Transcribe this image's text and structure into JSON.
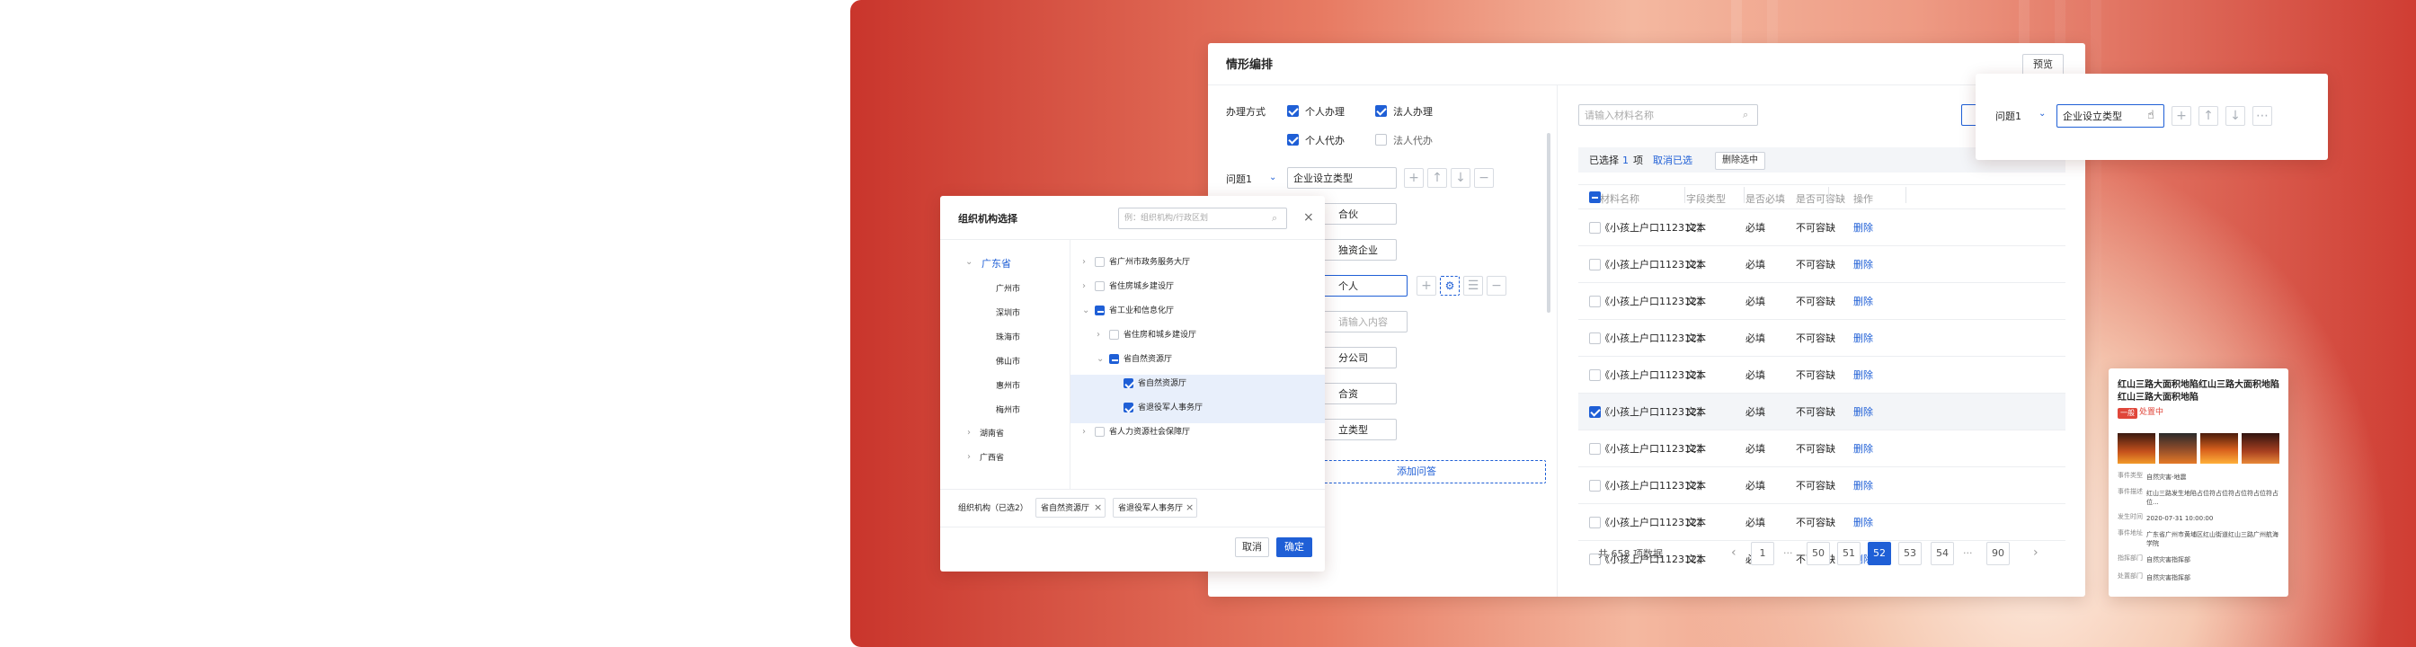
{
  "main": {
    "title": "情形编排",
    "preview_label": "预览",
    "handling_label": "办理方式",
    "handling_options": [
      {
        "label": "个人办理",
        "checked": true
      },
      {
        "label": "法人办理",
        "checked": true
      },
      {
        "label": "个人代办",
        "checked": true
      },
      {
        "label": "法人代办",
        "checked": false
      }
    ],
    "question_label": "问题1",
    "question_value": "企业设立类型",
    "answers": [
      "合伙",
      "独资企业",
      "个人",
      "请输入内容",
      "分公司",
      "合资",
      "立类型"
    ],
    "add_question_label": "添加问答",
    "material_search_placeholder": "请输入材料名称",
    "selected_prefix": "已选择",
    "selected_count": "1",
    "selected_suffix": "项",
    "cancel_selection": "取消已选",
    "delete_selected": "删除选中",
    "table": {
      "headers": [
        "材料名称",
        "字段类型",
        "是否必填",
        "是否可容缺",
        "操作"
      ],
      "rows": [
        {
          "name": "《小孩上户口112312》",
          "type": "文本",
          "required": "必填",
          "missing": "不可容缺",
          "action": "删除",
          "checked": false
        },
        {
          "name": "《小孩上户口112312》",
          "type": "文本",
          "required": "必填",
          "missing": "不可容缺",
          "action": "删除",
          "checked": false
        },
        {
          "name": "《小孩上户口112312》",
          "type": "文本",
          "required": "必填",
          "missing": "不可容缺",
          "action": "删除",
          "checked": false
        },
        {
          "name": "《小孩上户口112312》",
          "type": "文本",
          "required": "必填",
          "missing": "不可容缺",
          "action": "删除",
          "checked": false
        },
        {
          "name": "《小孩上户口112312》",
          "type": "文本",
          "required": "必填",
          "missing": "不可容缺",
          "action": "删除",
          "checked": false
        },
        {
          "name": "《小孩上户口112312》",
          "type": "文本",
          "required": "必填",
          "missing": "不可容缺",
          "action": "删除",
          "checked": true
        },
        {
          "name": "《小孩上户口112312》",
          "type": "文本",
          "required": "必填",
          "missing": "不可容缺",
          "action": "删除",
          "checked": false
        },
        {
          "name": "《小孩上户口112312》",
          "type": "文本",
          "required": "必填",
          "missing": "不可容缺",
          "action": "删除",
          "checked": false
        },
        {
          "name": "《小孩上户口112312》",
          "type": "文本",
          "required": "必填",
          "missing": "不可容缺",
          "action": "删除",
          "checked": false
        },
        {
          "name": "《小孩上户口112312》",
          "type": "文本",
          "required": "必填",
          "missing": "不可容缺",
          "action": "删除",
          "checked": false
        }
      ]
    },
    "total_text": "共 658 项数据",
    "pages": [
      "1",
      "···",
      "50",
      "51",
      "52",
      "53",
      "54",
      "···",
      "90"
    ],
    "current_page": "52"
  },
  "popover": {
    "question_label": "问题1",
    "question_value": "企业设立类型"
  },
  "org_dialog": {
    "title": "组织机构选择",
    "search_placeholder": "例：组织机构/行政区划",
    "regions": {
      "root": "广东省",
      "children": [
        "广州市",
        "深圳市",
        "珠海市",
        "佛山市",
        "惠州市",
        "梅州市"
      ],
      "others": [
        "湖南省",
        "广西省"
      ]
    },
    "orgs": [
      {
        "label": "省广州市政务服务大厅",
        "state": "off",
        "level": 0,
        "arrow": "right"
      },
      {
        "label": "省住房城乡建设厅",
        "state": "off",
        "level": 0,
        "arrow": "right"
      },
      {
        "label": "省工业和信息化厅",
        "state": "ind",
        "level": 0,
        "arrow": "down"
      },
      {
        "label": "省住房和城乡建设厅",
        "state": "off",
        "level": 1,
        "arrow": "right"
      },
      {
        "label": "省自然资源厅",
        "state": "ind",
        "level": 1,
        "arrow": "down"
      },
      {
        "label": "省自然资源厅",
        "state": "on",
        "level": 2,
        "arrow": ""
      },
      {
        "label": "省退役军人事务厅",
        "state": "on",
        "level": 2,
        "arrow": ""
      },
      {
        "label": "省人力资源社会保障厅",
        "state": "off",
        "level": 0,
        "arrow": "right"
      }
    ],
    "selected_label": "组织机构（已选2）",
    "selected_tags": [
      "省自然资源厅",
      "省退役军人事务厅"
    ],
    "cancel_label": "取消",
    "confirm_label": "确定"
  },
  "event_card": {
    "title": "红山三路大面积地陷红山三路大面积地陷红山三路大面积地陷",
    "badge": "一般",
    "status": "处置中",
    "fields": [
      {
        "label": "事件类型",
        "value": "自然灾害-地震"
      },
      {
        "label": "事件描述",
        "value": "红山三路发生地陷占位符占位符占位符占位符占位..."
      },
      {
        "label": "发生时间",
        "value": "2020-07-31 10:00:00"
      },
      {
        "label": "事件地址",
        "value": "广东省广州市黄埔区红山街道红山三路广州航海学院"
      },
      {
        "label": "指挥部门",
        "value": "自然灾害指挥部"
      },
      {
        "label": "处置部门",
        "value": "自然灾害指挥部"
      }
    ]
  },
  "colors": {
    "primary": "#1f5fd6",
    "danger": "#e0463a"
  }
}
